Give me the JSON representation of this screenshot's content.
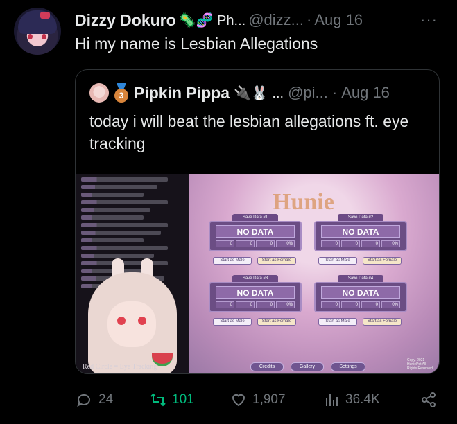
{
  "tweet": {
    "author_name": "Dizzy Dokuro",
    "author_emoji": "🦠🧬 Ph...",
    "author_handle": "@dizz...",
    "separator": "·",
    "date": "Aug 16",
    "more": "···",
    "text": "Hi my name is Lesbian Allegations"
  },
  "quote": {
    "medal_number": "3",
    "author_name": "Pipkin Pippa",
    "author_emoji": "🔌🐰 ...",
    "author_handle": "@pi...",
    "separator": "·",
    "date": "Aug 16",
    "text": "today i will beat the lesbian allegations ft. eye tracking"
  },
  "media": {
    "caption": "Red Circle = Eye Tracking",
    "game_title": "Hunie",
    "slots": [
      {
        "tab": "Save Data #1",
        "status": "NO DATA",
        "stats": [
          "0",
          "0",
          "0",
          "0%"
        ],
        "male_btn": "Start as Male",
        "female_btn": "Start as Female"
      },
      {
        "tab": "Save Data #2",
        "status": "NO DATA",
        "stats": [
          "0",
          "0",
          "0",
          "0%"
        ],
        "male_btn": "Start as Male",
        "female_btn": "Start as Female"
      },
      {
        "tab": "Save Data #3",
        "status": "NO DATA",
        "stats": [
          "0",
          "0",
          "0",
          "0%"
        ],
        "male_btn": "Start as Male",
        "female_btn": "Start as Female"
      },
      {
        "tab": "Save Data #4",
        "status": "NO DATA",
        "stats": [
          "0",
          "0",
          "0",
          "0%"
        ],
        "male_btn": "Start as Male",
        "female_btn": "Start as Female"
      }
    ],
    "menu": {
      "credits": "Credits",
      "gallery": "Gallery",
      "settings": "Settings"
    },
    "copyright": "Copy. 2021 HuniePot All Rights Reserved"
  },
  "actions": {
    "replies": "24",
    "retweets": "101",
    "likes": "1,907",
    "views": "36.4K"
  },
  "colors": {
    "background": "#000000",
    "text": "#e7e9ea",
    "muted": "#71767b",
    "retweet_green": "#00ba7c",
    "border": "#2f3336"
  }
}
